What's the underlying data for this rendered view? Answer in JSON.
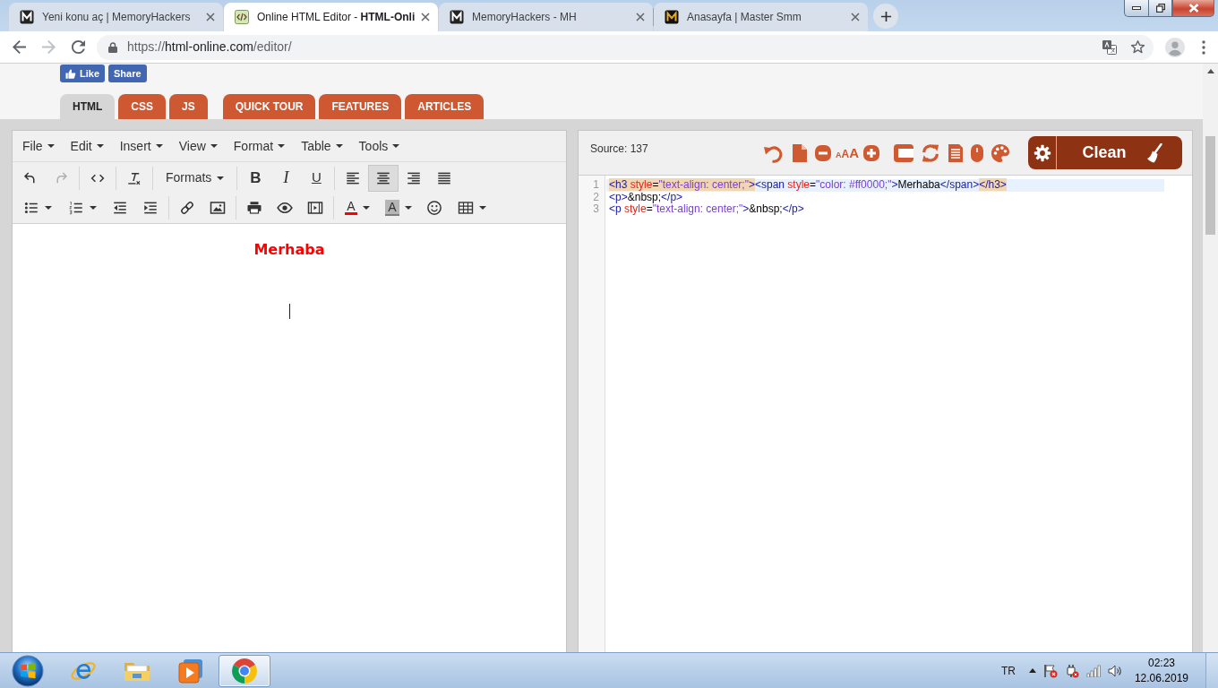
{
  "browser": {
    "tabs": [
      {
        "title": "Yeni konu aç | MemoryHackers",
        "selected": false
      },
      {
        "title": "Online HTML Editor - **HTML-Onli**",
        "selected": true
      },
      {
        "title": "MemoryHackers - MH",
        "selected": false
      },
      {
        "title": "Anasayfa | Master Smm",
        "selected": false
      }
    ],
    "nav_buttons": [
      {
        "disabled": false
      },
      {
        "disabled": true
      },
      {
        "disabled": false
      }
    ],
    "address": {
      "scheme": "https://",
      "host": "html-online.com",
      "path": "/editor/"
    }
  },
  "page": {
    "social_buttons": [
      {
        "kind": "like",
        "label": "Like"
      },
      {
        "kind": "share",
        "label": "Share"
      }
    ],
    "editor_tabs": [
      {
        "label": "HTML",
        "selected": true
      },
      {
        "label": "CSS",
        "selected": false
      },
      {
        "label": "JS",
        "selected": false
      }
    ],
    "site_links": [
      "QUICK TOUR",
      "FEATURES",
      "ARTICLES"
    ]
  },
  "editor": {
    "menu": [
      "File",
      "Edit",
      "Insert",
      "View",
      "Format",
      "Table",
      "Tools"
    ],
    "history_buttons": [
      {
        "disabled": false
      },
      {
        "disabled": true
      }
    ],
    "formats_label": "Formats",
    "style_buttons": [
      "B",
      "I",
      "U"
    ],
    "align_buttons": [
      {
        "selected": false
      },
      {
        "selected": true
      },
      {
        "selected": false
      },
      {
        "selected": false
      }
    ],
    "text_color_label": "A",
    "background_color_label": "A",
    "heading": "Merhaba"
  },
  "source": {
    "label": "Source: 137",
    "font_size_label": "AAA",
    "clean_label": "Clean",
    "lines": [
      {
        "number": "1",
        "selected": true,
        "segments": [
          {
            "matched": true,
            "tokens": [
              {
                "kind": "tag",
                "text": "<h3"
              },
              {
                "kind": "attr",
                "text": " style"
              },
              {
                "kind": "plain",
                "text": "="
              },
              {
                "kind": "string",
                "text": "\"text-align: center;\""
              },
              {
                "kind": "tag",
                "text": ">"
              }
            ]
          },
          {
            "matched": false,
            "tokens": [
              {
                "kind": "tag",
                "text": "<span"
              },
              {
                "kind": "attr",
                "text": " style"
              },
              {
                "kind": "plain",
                "text": "="
              },
              {
                "kind": "string",
                "text": "\"color: #ff0000;\""
              },
              {
                "kind": "tag",
                "text": ">"
              },
              {
                "kind": "plain",
                "text": "Merhaba"
              },
              {
                "kind": "tag",
                "text": "</span>"
              }
            ]
          },
          {
            "matched": true,
            "tokens": [
              {
                "kind": "tag",
                "text": "</h3>"
              }
            ]
          }
        ]
      },
      {
        "number": "2",
        "selected": false,
        "segments": [
          {
            "matched": false,
            "tokens": [
              {
                "kind": "tag",
                "text": "<p>"
              },
              {
                "kind": "plain",
                "text": "&nbsp;"
              },
              {
                "kind": "tag",
                "text": "</p>"
              }
            ]
          }
        ]
      },
      {
        "number": "3",
        "selected": false,
        "segments": [
          {
            "matched": false,
            "tokens": [
              {
                "kind": "tag",
                "text": "<p"
              },
              {
                "kind": "attr",
                "text": " style"
              },
              {
                "kind": "plain",
                "text": "="
              },
              {
                "kind": "string",
                "text": "\"text-align: center;\""
              },
              {
                "kind": "tag",
                "text": ">"
              },
              {
                "kind": "plain",
                "text": "&nbsp;"
              },
              {
                "kind": "tag",
                "text": "</p>"
              }
            ]
          }
        ]
      }
    ]
  },
  "taskbar": {
    "apps": [
      {
        "selected": false
      },
      {
        "selected": false
      },
      {
        "selected": false
      },
      {
        "selected": true
      }
    ],
    "language": "TR",
    "time": "02:23",
    "date": "12.06.2019"
  }
}
